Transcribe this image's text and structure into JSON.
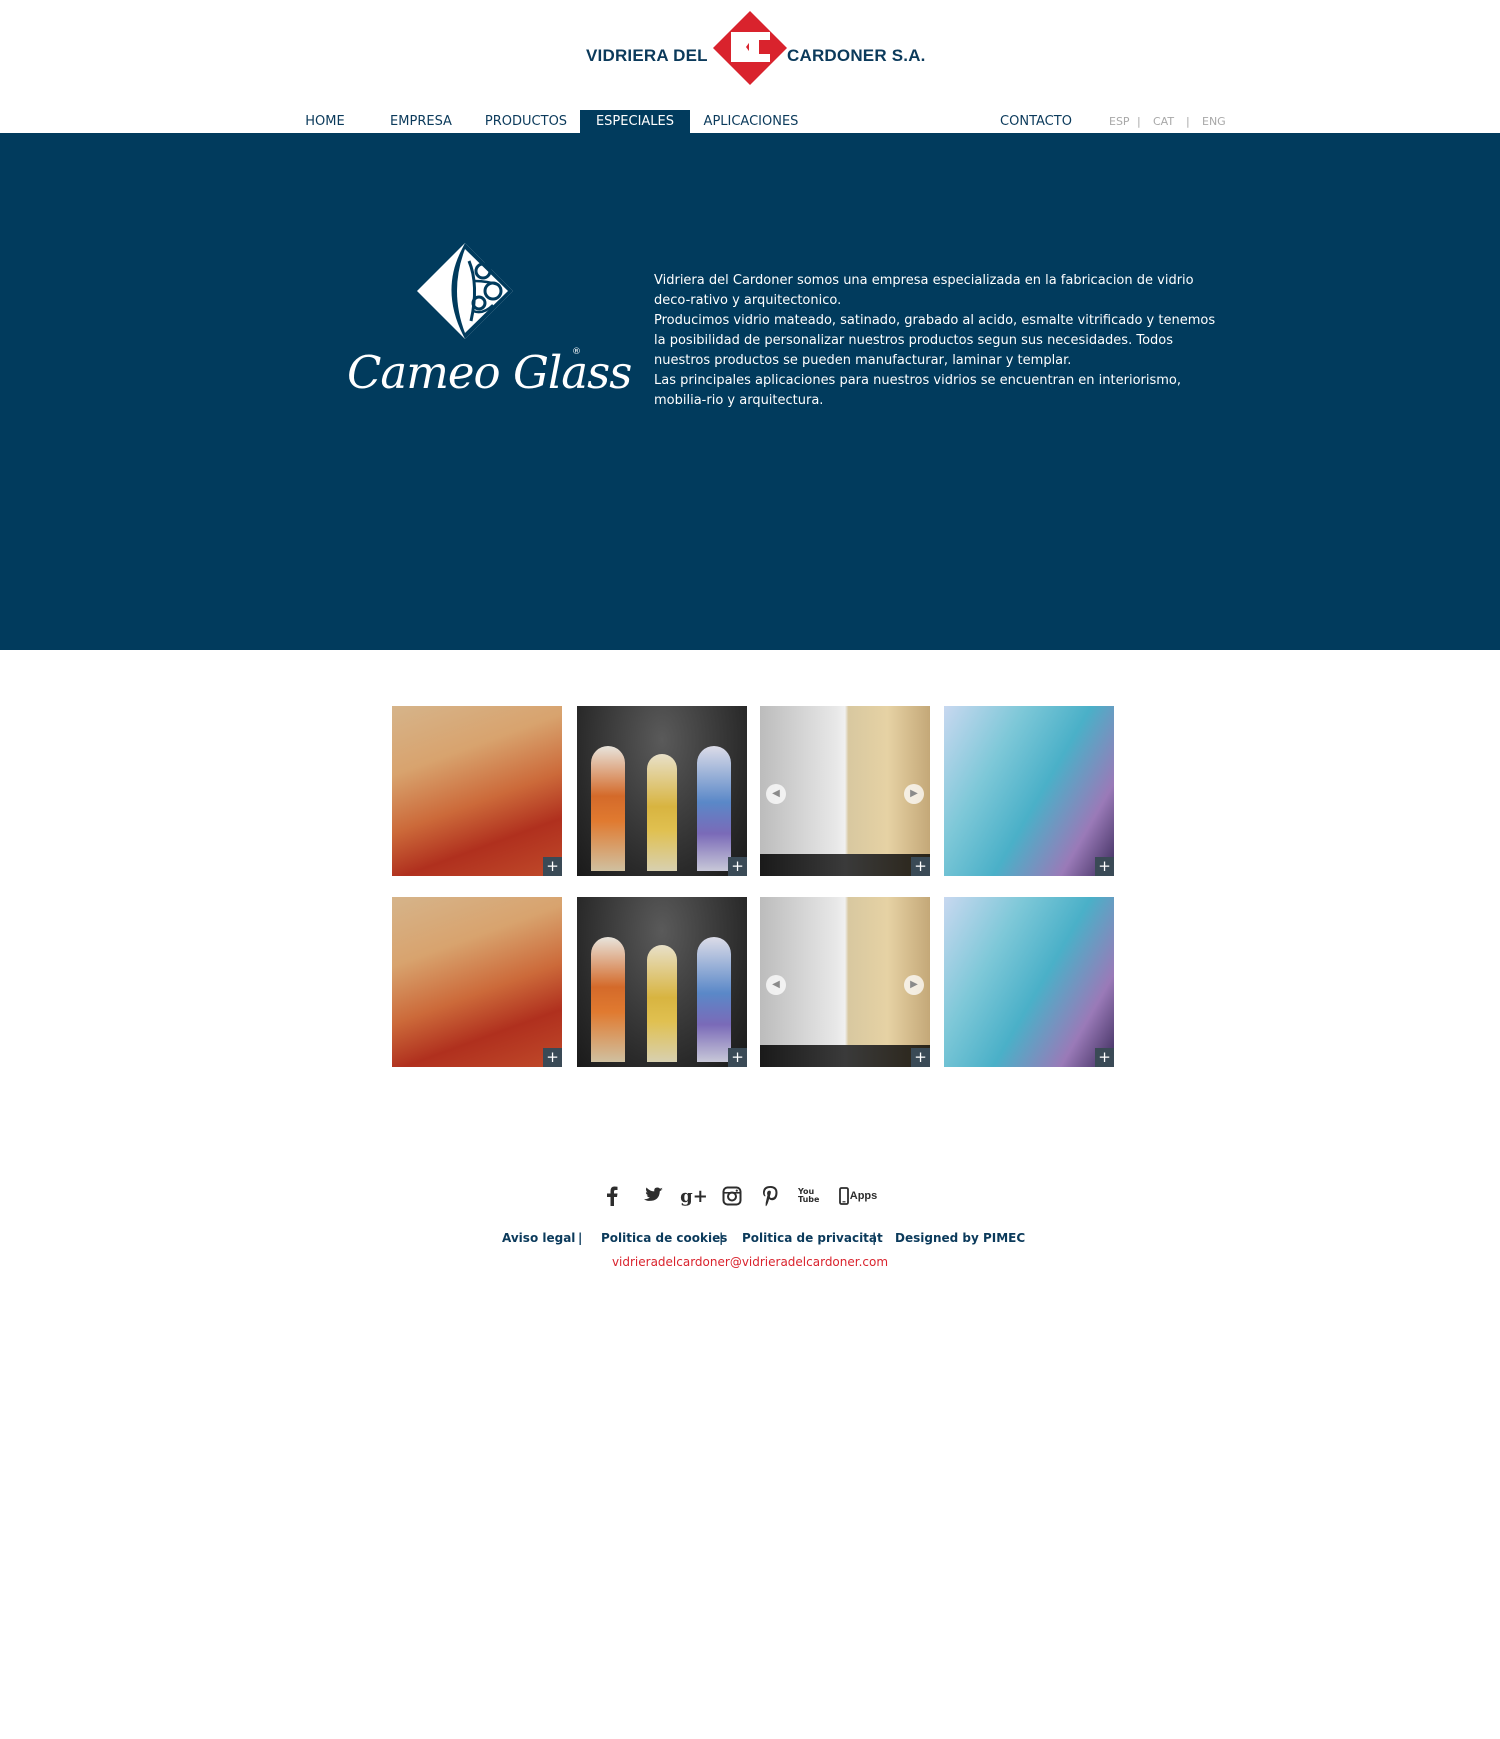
{
  "brand": {
    "left_text": "VIDRIERA DEL",
    "right_text": "CARDONER S.A.",
    "colors": {
      "red": "#d9232d",
      "navy": "#013b5d"
    }
  },
  "nav": {
    "items": [
      {
        "label": "HOME",
        "active": false
      },
      {
        "label": "EMPRESA",
        "active": false
      },
      {
        "label": "PRODUCTOS",
        "active": false
      },
      {
        "label": "ESPECIALES",
        "active": true
      },
      {
        "label": "APLICACIONES",
        "active": false
      },
      {
        "label": "CONTACTO",
        "active": false
      }
    ],
    "languages": [
      "ESP",
      "CAT",
      "ENG"
    ],
    "lang_separator": "|"
  },
  "hero": {
    "brand_name": "Cameo Glass",
    "registered": "®",
    "paragraphs": [
      "Vidriera del Cardoner somos una empresa especializada en la fabricacion de vidrio deco-rativo y arquitectonico.",
      "Producimos vidrio mateado, satinado, grabado al acido, esmalte vitrificado y tenemos la posibilidad de personalizar nuestros productos segun sus necesidades. Todos nuestros productos se pueden manufacturar, laminar y templar.",
      "Las principales aplicaciones para nuestros vidrios se encuentran en interiorismo, mobilia-rio y arquitectura."
    ]
  },
  "gallery": {
    "expand_label": "+",
    "prev_label": "◀",
    "next_label": "▶",
    "tiles": [
      {
        "kind": "orange-texture"
      },
      {
        "kind": "cathedral-windows"
      },
      {
        "kind": "before-after"
      },
      {
        "kind": "blue-texture"
      },
      {
        "kind": "orange-texture"
      },
      {
        "kind": "cathedral-windows"
      },
      {
        "kind": "before-after"
      },
      {
        "kind": "blue-texture"
      }
    ]
  },
  "social": {
    "icons": [
      "facebook-icon",
      "twitter-icon",
      "google-plus-icon",
      "instagram-icon",
      "pinterest-icon",
      "youtube-icon",
      "apps-icon"
    ],
    "gplus_text": "g+",
    "youtube_text": "You Tube",
    "apps_text": "Apps"
  },
  "footer": {
    "links": [
      "Aviso legal",
      "Politica de cookies",
      "Politica de privacitat",
      "Designed by PIMEC"
    ],
    "separator": "|",
    "email": "vidrieradelcardoner@vidrieradelcardoner.com"
  }
}
